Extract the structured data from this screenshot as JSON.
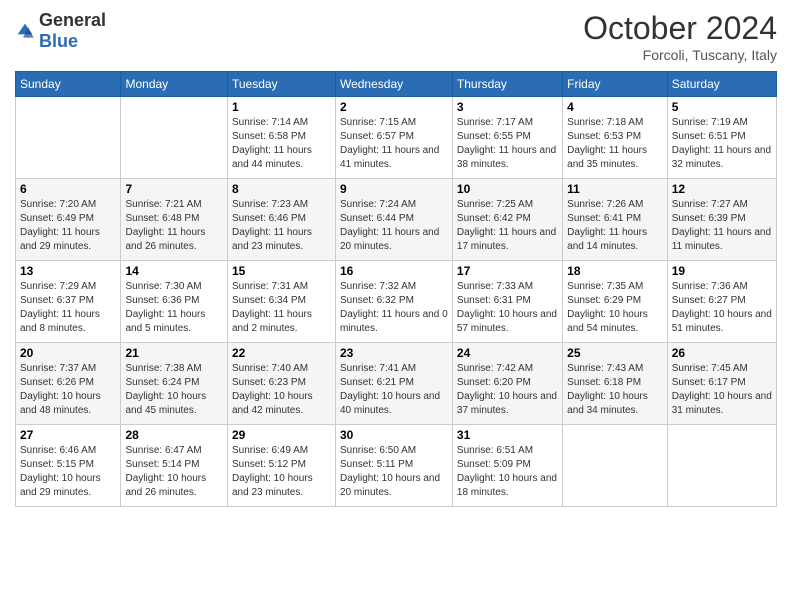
{
  "logo": {
    "general": "General",
    "blue": "Blue"
  },
  "title": "October 2024",
  "location": "Forcoli, Tuscany, Italy",
  "days_header": [
    "Sunday",
    "Monday",
    "Tuesday",
    "Wednesday",
    "Thursday",
    "Friday",
    "Saturday"
  ],
  "weeks": [
    [
      {
        "day": "",
        "sunrise": "",
        "sunset": "",
        "daylight": ""
      },
      {
        "day": "",
        "sunrise": "",
        "sunset": "",
        "daylight": ""
      },
      {
        "day": "1",
        "sunrise": "Sunrise: 7:14 AM",
        "sunset": "Sunset: 6:58 PM",
        "daylight": "Daylight: 11 hours and 44 minutes."
      },
      {
        "day": "2",
        "sunrise": "Sunrise: 7:15 AM",
        "sunset": "Sunset: 6:57 PM",
        "daylight": "Daylight: 11 hours and 41 minutes."
      },
      {
        "day": "3",
        "sunrise": "Sunrise: 7:17 AM",
        "sunset": "Sunset: 6:55 PM",
        "daylight": "Daylight: 11 hours and 38 minutes."
      },
      {
        "day": "4",
        "sunrise": "Sunrise: 7:18 AM",
        "sunset": "Sunset: 6:53 PM",
        "daylight": "Daylight: 11 hours and 35 minutes."
      },
      {
        "day": "5",
        "sunrise": "Sunrise: 7:19 AM",
        "sunset": "Sunset: 6:51 PM",
        "daylight": "Daylight: 11 hours and 32 minutes."
      }
    ],
    [
      {
        "day": "6",
        "sunrise": "Sunrise: 7:20 AM",
        "sunset": "Sunset: 6:49 PM",
        "daylight": "Daylight: 11 hours and 29 minutes."
      },
      {
        "day": "7",
        "sunrise": "Sunrise: 7:21 AM",
        "sunset": "Sunset: 6:48 PM",
        "daylight": "Daylight: 11 hours and 26 minutes."
      },
      {
        "day": "8",
        "sunrise": "Sunrise: 7:23 AM",
        "sunset": "Sunset: 6:46 PM",
        "daylight": "Daylight: 11 hours and 23 minutes."
      },
      {
        "day": "9",
        "sunrise": "Sunrise: 7:24 AM",
        "sunset": "Sunset: 6:44 PM",
        "daylight": "Daylight: 11 hours and 20 minutes."
      },
      {
        "day": "10",
        "sunrise": "Sunrise: 7:25 AM",
        "sunset": "Sunset: 6:42 PM",
        "daylight": "Daylight: 11 hours and 17 minutes."
      },
      {
        "day": "11",
        "sunrise": "Sunrise: 7:26 AM",
        "sunset": "Sunset: 6:41 PM",
        "daylight": "Daylight: 11 hours and 14 minutes."
      },
      {
        "day": "12",
        "sunrise": "Sunrise: 7:27 AM",
        "sunset": "Sunset: 6:39 PM",
        "daylight": "Daylight: 11 hours and 11 minutes."
      }
    ],
    [
      {
        "day": "13",
        "sunrise": "Sunrise: 7:29 AM",
        "sunset": "Sunset: 6:37 PM",
        "daylight": "Daylight: 11 hours and 8 minutes."
      },
      {
        "day": "14",
        "sunrise": "Sunrise: 7:30 AM",
        "sunset": "Sunset: 6:36 PM",
        "daylight": "Daylight: 11 hours and 5 minutes."
      },
      {
        "day": "15",
        "sunrise": "Sunrise: 7:31 AM",
        "sunset": "Sunset: 6:34 PM",
        "daylight": "Daylight: 11 hours and 2 minutes."
      },
      {
        "day": "16",
        "sunrise": "Sunrise: 7:32 AM",
        "sunset": "Sunset: 6:32 PM",
        "daylight": "Daylight: 11 hours and 0 minutes."
      },
      {
        "day": "17",
        "sunrise": "Sunrise: 7:33 AM",
        "sunset": "Sunset: 6:31 PM",
        "daylight": "Daylight: 10 hours and 57 minutes."
      },
      {
        "day": "18",
        "sunrise": "Sunrise: 7:35 AM",
        "sunset": "Sunset: 6:29 PM",
        "daylight": "Daylight: 10 hours and 54 minutes."
      },
      {
        "day": "19",
        "sunrise": "Sunrise: 7:36 AM",
        "sunset": "Sunset: 6:27 PM",
        "daylight": "Daylight: 10 hours and 51 minutes."
      }
    ],
    [
      {
        "day": "20",
        "sunrise": "Sunrise: 7:37 AM",
        "sunset": "Sunset: 6:26 PM",
        "daylight": "Daylight: 10 hours and 48 minutes."
      },
      {
        "day": "21",
        "sunrise": "Sunrise: 7:38 AM",
        "sunset": "Sunset: 6:24 PM",
        "daylight": "Daylight: 10 hours and 45 minutes."
      },
      {
        "day": "22",
        "sunrise": "Sunrise: 7:40 AM",
        "sunset": "Sunset: 6:23 PM",
        "daylight": "Daylight: 10 hours and 42 minutes."
      },
      {
        "day": "23",
        "sunrise": "Sunrise: 7:41 AM",
        "sunset": "Sunset: 6:21 PM",
        "daylight": "Daylight: 10 hours and 40 minutes."
      },
      {
        "day": "24",
        "sunrise": "Sunrise: 7:42 AM",
        "sunset": "Sunset: 6:20 PM",
        "daylight": "Daylight: 10 hours and 37 minutes."
      },
      {
        "day": "25",
        "sunrise": "Sunrise: 7:43 AM",
        "sunset": "Sunset: 6:18 PM",
        "daylight": "Daylight: 10 hours and 34 minutes."
      },
      {
        "day": "26",
        "sunrise": "Sunrise: 7:45 AM",
        "sunset": "Sunset: 6:17 PM",
        "daylight": "Daylight: 10 hours and 31 minutes."
      }
    ],
    [
      {
        "day": "27",
        "sunrise": "Sunrise: 6:46 AM",
        "sunset": "Sunset: 5:15 PM",
        "daylight": "Daylight: 10 hours and 29 minutes."
      },
      {
        "day": "28",
        "sunrise": "Sunrise: 6:47 AM",
        "sunset": "Sunset: 5:14 PM",
        "daylight": "Daylight: 10 hours and 26 minutes."
      },
      {
        "day": "29",
        "sunrise": "Sunrise: 6:49 AM",
        "sunset": "Sunset: 5:12 PM",
        "daylight": "Daylight: 10 hours and 23 minutes."
      },
      {
        "day": "30",
        "sunrise": "Sunrise: 6:50 AM",
        "sunset": "Sunset: 5:11 PM",
        "daylight": "Daylight: 10 hours and 20 minutes."
      },
      {
        "day": "31",
        "sunrise": "Sunrise: 6:51 AM",
        "sunset": "Sunset: 5:09 PM",
        "daylight": "Daylight: 10 hours and 18 minutes."
      },
      {
        "day": "",
        "sunrise": "",
        "sunset": "",
        "daylight": ""
      },
      {
        "day": "",
        "sunrise": "",
        "sunset": "",
        "daylight": ""
      }
    ]
  ]
}
